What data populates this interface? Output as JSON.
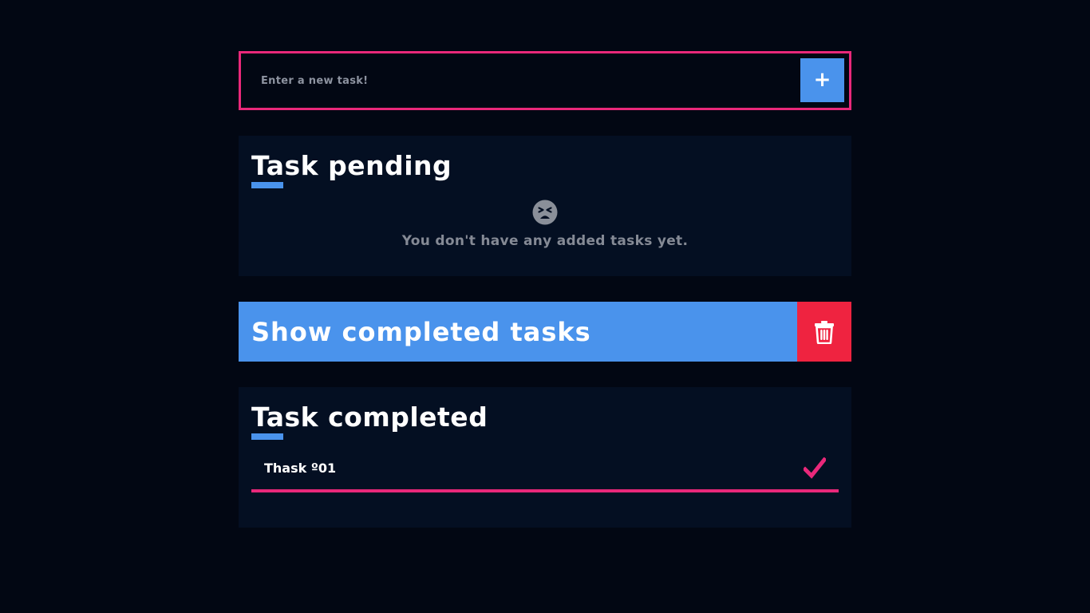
{
  "new_task": {
    "placeholder": "Enter a new task!",
    "value": "",
    "add_button_label": "+"
  },
  "pending": {
    "title": "Task pending",
    "empty_icon": "tired-face-icon",
    "empty_message": "You don't have any added tasks yet."
  },
  "completed_toggle": {
    "label": "Show completed tasks",
    "delete_icon": "trash-icon"
  },
  "completed": {
    "title": "Task completed",
    "items": [
      {
        "label": "Thask º01",
        "status_icon": "check-icon"
      }
    ]
  },
  "colors": {
    "background": "#020713",
    "panel": "#040f22",
    "accent_blue": "#4a93ec",
    "accent_pink": "#e9287a",
    "danger_red": "#ef2340",
    "muted_text": "#858a95"
  }
}
